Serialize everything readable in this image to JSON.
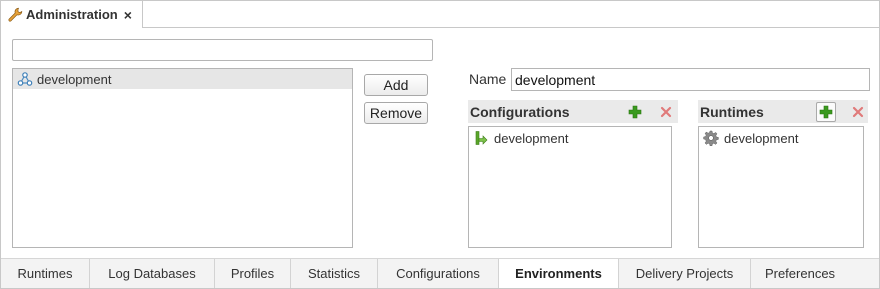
{
  "tab": {
    "title": "Administration",
    "close": "×",
    "icon": "wrench-icon"
  },
  "filter": {
    "value": "",
    "placeholder": ""
  },
  "environments": [
    {
      "label": "development",
      "icon": "environment-network-icon"
    }
  ],
  "buttons": {
    "add": "Add",
    "remove": "Remove"
  },
  "details": {
    "name_label": "Name",
    "name_value": "development"
  },
  "configurations": {
    "title": "Configurations",
    "items": [
      {
        "label": "development",
        "icon": "configuration-branch-icon"
      }
    ]
  },
  "runtimes": {
    "title": "Runtimes",
    "items": [
      {
        "label": "development",
        "icon": "gear-icon"
      }
    ]
  },
  "bottom_tabs": [
    {
      "label": "Runtimes",
      "active": false
    },
    {
      "label": "Log Databases",
      "active": false
    },
    {
      "label": "Profiles",
      "active": false
    },
    {
      "label": "Statistics",
      "active": false
    },
    {
      "label": "Configurations",
      "active": false
    },
    {
      "label": "Environments",
      "active": true
    },
    {
      "label": "Delivery Projects",
      "active": false
    },
    {
      "label": "Preferences",
      "active": false
    }
  ],
  "colors": {
    "add_green": "#3a9a1e",
    "remove_red": "#e07a7a",
    "selection_bg": "#e6e6e6",
    "header_bg": "#eaeaea"
  }
}
